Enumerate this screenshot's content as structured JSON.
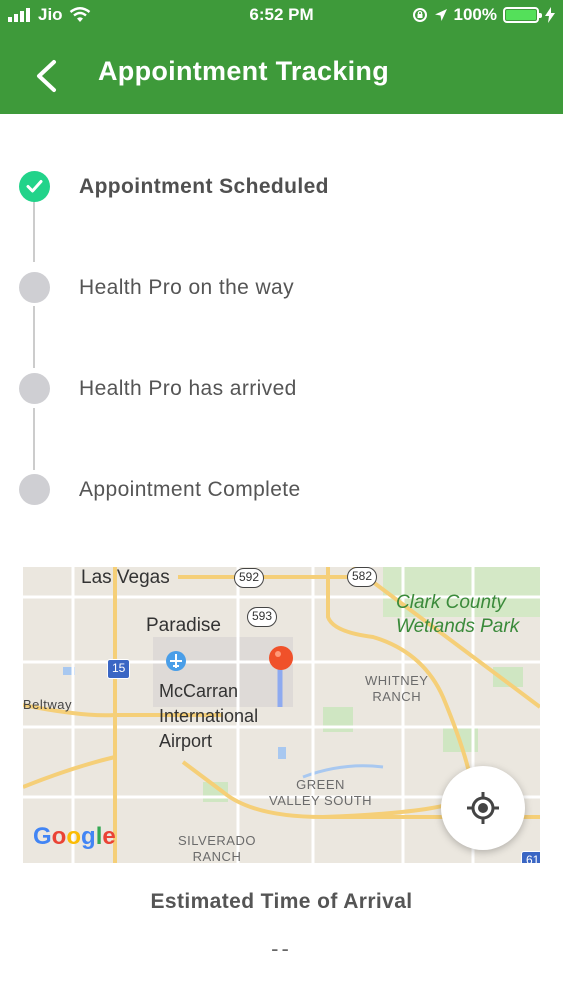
{
  "status_bar": {
    "carrier": "Jio",
    "time": "6:52 PM",
    "battery": "100%",
    "battery_level": 1.0
  },
  "header": {
    "title": "Appointment Tracking",
    "back_icon": "chevron-left-icon"
  },
  "steps": [
    {
      "label": "Appointment Scheduled",
      "completed": true
    },
    {
      "label": "Health Pro on the way",
      "completed": false
    },
    {
      "label": "Health Pro has arrived",
      "completed": false
    },
    {
      "label": "Appointment Complete",
      "completed": false
    }
  ],
  "map": {
    "labels": {
      "las_vegas": "Las Vegas",
      "paradise": "Paradise",
      "airport": "McCarran\nInternational\nAirport",
      "beltway": "Beltway",
      "whitney": "WHITNEY\nRANCH",
      "green_valley": "GREEN\nVALLEY SOUTH",
      "silverado": "SILVERADO\nRANCH",
      "park": "Clark County\nWetlands Park",
      "google": "Google"
    },
    "shields": {
      "r592": "592",
      "r582": "582",
      "r593": "593",
      "i15": "15",
      "i61": "61"
    },
    "locate_icon": "crosshair-icon"
  },
  "eta": {
    "title": "Estimated Time of Arrival",
    "value": "--"
  },
  "colors": {
    "header": "#3e9a3a",
    "step_done": "#22d38a",
    "step_pending": "#cfcfd3",
    "pin": "#f0512a"
  }
}
